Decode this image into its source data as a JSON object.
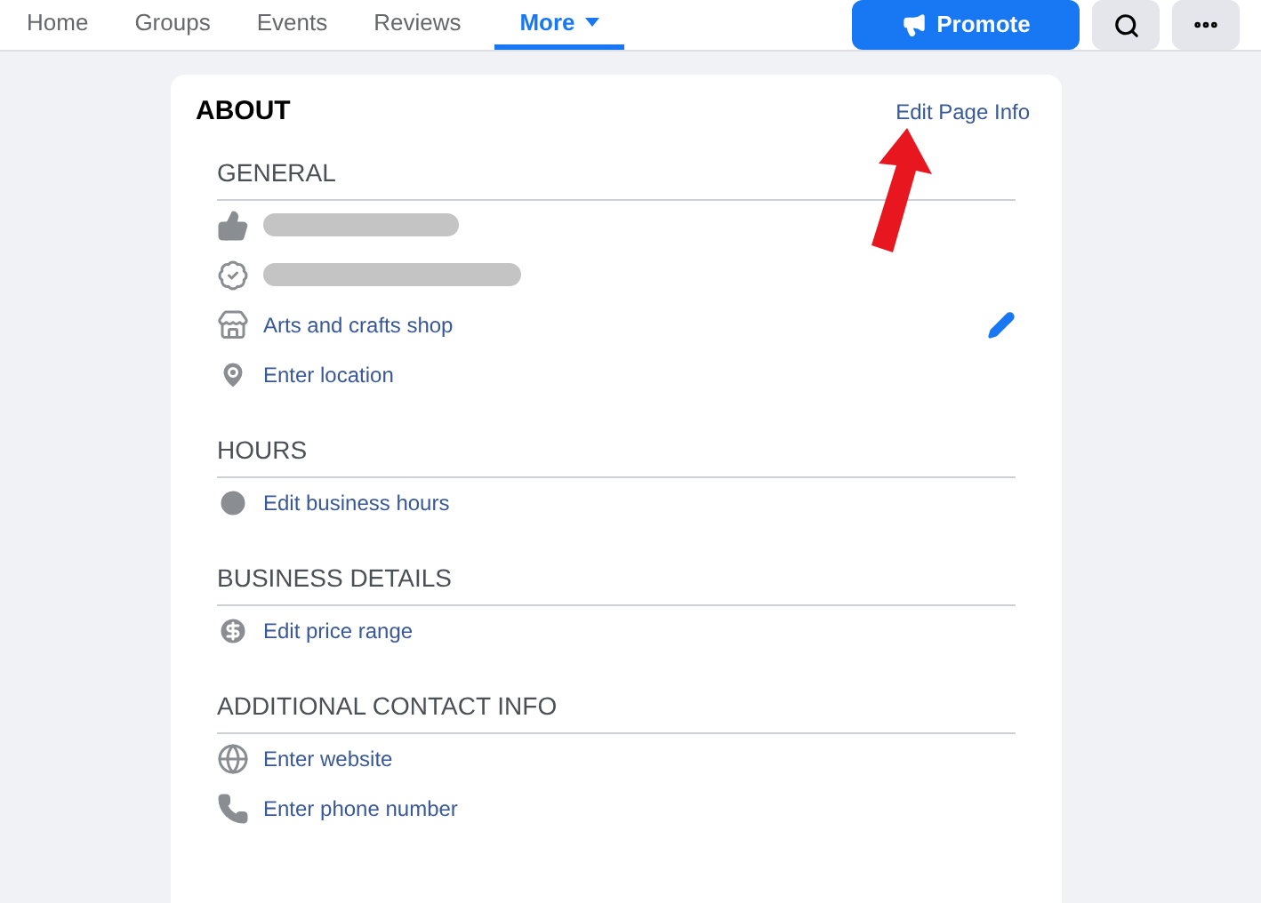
{
  "nav": {
    "tabs": [
      {
        "label": "Home",
        "selected": false
      },
      {
        "label": "Groups",
        "selected": false
      },
      {
        "label": "Events",
        "selected": false
      },
      {
        "label": "Reviews",
        "selected": false
      },
      {
        "label": "More",
        "selected": true,
        "dropdown": true
      }
    ],
    "promote": "Promote"
  },
  "about": {
    "title": "ABOUT",
    "edit_link": "Edit Page Info",
    "annotation": true,
    "sections": [
      {
        "heading": "GENERAL",
        "rows": [
          {
            "kind": "likes",
            "redacted": true
          },
          {
            "kind": "verified",
            "redacted": true
          },
          {
            "kind": "category",
            "text": "Arts and crafts shop",
            "editable": true
          },
          {
            "kind": "location",
            "text": "Enter location",
            "editable": false
          }
        ]
      },
      {
        "heading": "HOURS",
        "rows": [
          {
            "kind": "hours",
            "text": "Edit business hours",
            "editable": false
          }
        ]
      },
      {
        "heading": "BUSINESS DETAILS",
        "rows": [
          {
            "kind": "price",
            "text": "Edit price range",
            "editable": false
          }
        ]
      },
      {
        "heading": "ADDITIONAL CONTACT INFO",
        "rows": [
          {
            "kind": "website",
            "text": "Enter website",
            "editable": false
          },
          {
            "kind": "phone",
            "text": "Enter phone number",
            "editable": false
          }
        ]
      }
    ]
  }
}
